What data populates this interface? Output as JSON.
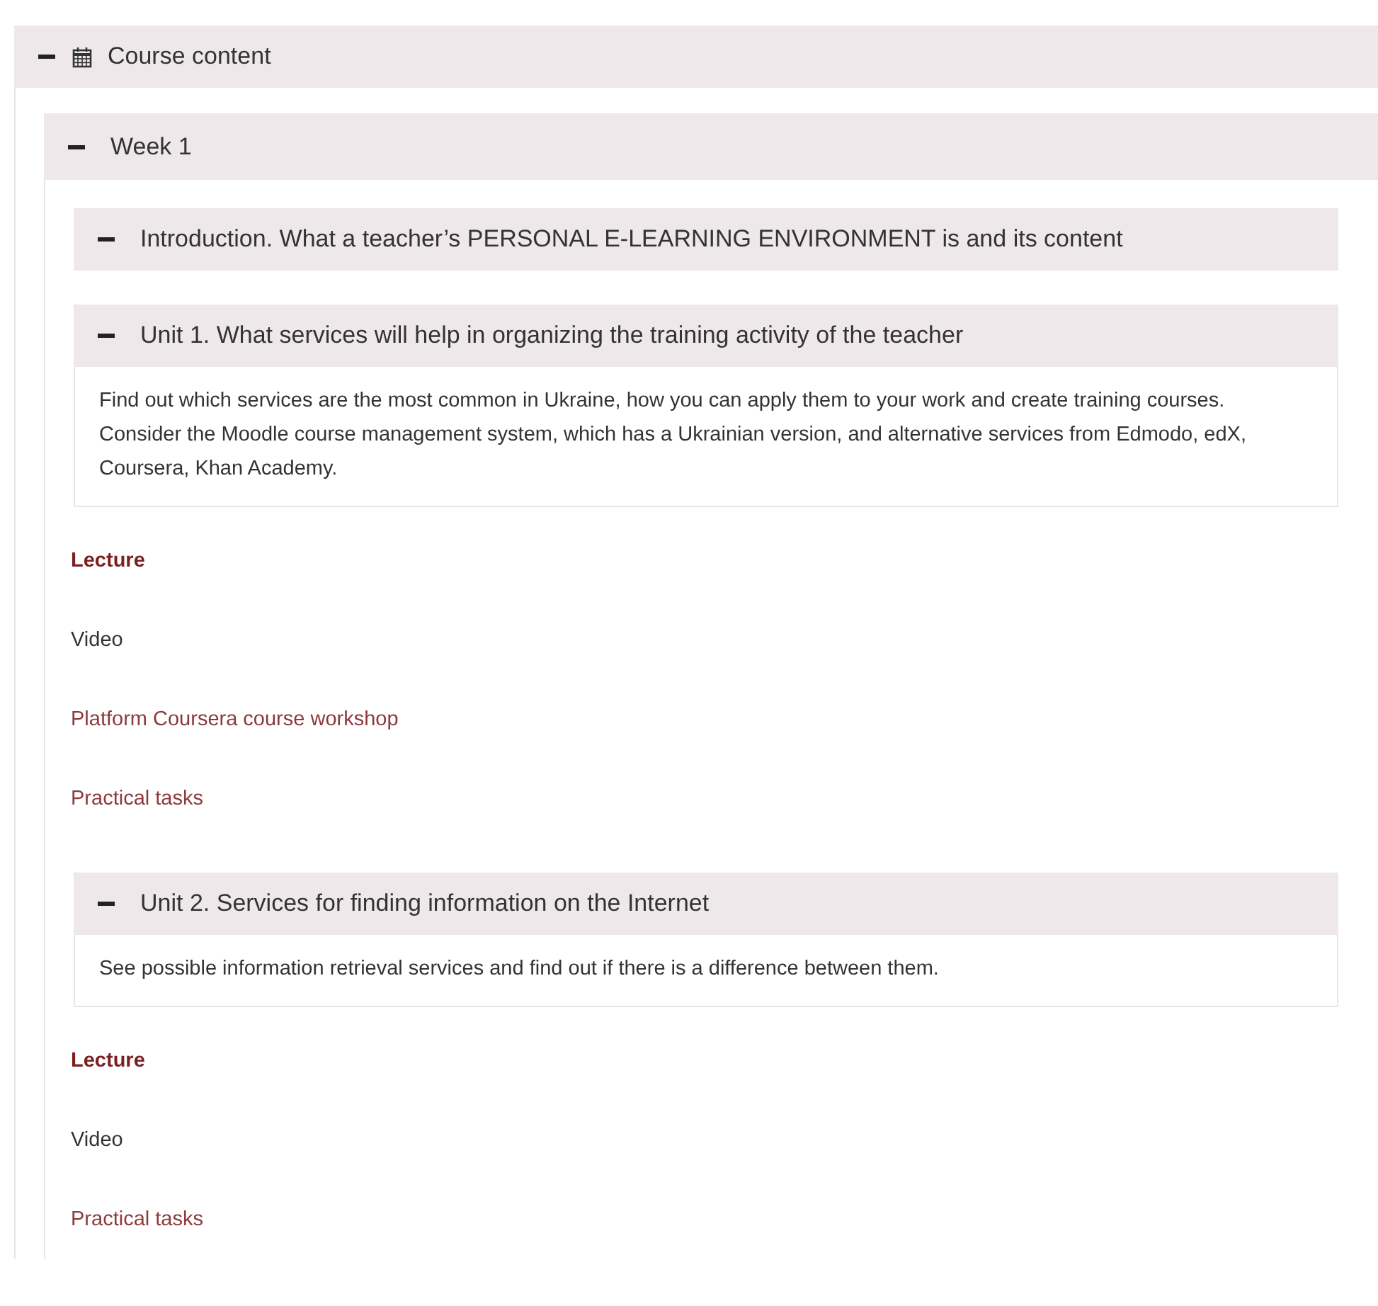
{
  "course": {
    "title": "Course content",
    "expanded": true,
    "weeks": [
      {
        "title": "Week 1",
        "expanded": true,
        "sections": [
          {
            "title": "Introduction. What a teacher’s PERSONAL E-LEARNING ENVIRONMENT is and its content",
            "expanded": true
          },
          {
            "title": "Unit 1. What services will help in organizing the training activity of the teacher",
            "expanded": true,
            "summary": "Find out which services are the most common in Ukraine, how you can apply them to your work and create training courses. Consider the Moodle course management system, which has a Ukrainian version, and alternative services from Edmodo, edX, Coursera, Khan Academy.",
            "items": [
              {
                "kind": "heading-link",
                "text": "Lecture"
              },
              {
                "kind": "text",
                "text": "Video"
              },
              {
                "kind": "link",
                "text": "Platform Coursera course workshop"
              },
              {
                "kind": "link",
                "text": "Practical tasks"
              }
            ]
          },
          {
            "title": "Unit 2. Services for finding information on the Internet",
            "expanded": true,
            "summary": "See possible information retrieval services and find out if there is a difference between them.",
            "items": [
              {
                "kind": "heading-link",
                "text": "Lecture"
              },
              {
                "kind": "text",
                "text": "Video"
              },
              {
                "kind": "link",
                "text": "Practical tasks"
              }
            ]
          }
        ]
      }
    ]
  }
}
